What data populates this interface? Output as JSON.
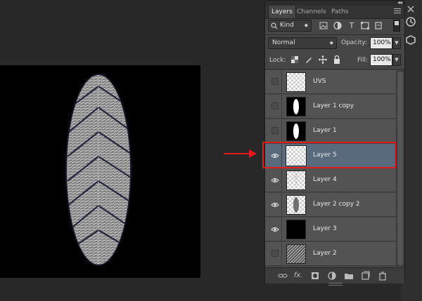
{
  "panel": {
    "tabs": [
      "Layers",
      "Channels",
      "Paths"
    ],
    "collapse": "◂◂",
    "filter": {
      "kind_label": "Kind"
    },
    "blend": {
      "mode": "Normal",
      "opacity_label": "Opacity:",
      "opacity_value": "100%"
    },
    "lock": {
      "label": "Lock:",
      "fill_label": "Fill:",
      "fill_value": "100%"
    },
    "layers": [
      {
        "name": "UVS",
        "visible": false,
        "thumb": "transparent"
      },
      {
        "name": "Layer 1 copy",
        "visible": false,
        "thumb": "white-shape"
      },
      {
        "name": "Layer 1",
        "visible": false,
        "thumb": "white-shape"
      },
      {
        "name": "Layer 5",
        "visible": true,
        "thumb": "transparent",
        "selected": true
      },
      {
        "name": "Layer 4",
        "visible": true,
        "thumb": "transparent"
      },
      {
        "name": "Layer 2 copy 2",
        "visible": true,
        "thumb": "feather"
      },
      {
        "name": "Layer 3",
        "visible": true,
        "thumb": "black"
      },
      {
        "name": "Layer 2",
        "visible": false,
        "thumb": "texture"
      }
    ],
    "footer_icons": [
      "link-icon",
      "fx-icon",
      "mask-icon",
      "adjustment-icon",
      "group-icon",
      "new-layer-icon",
      "trash-icon"
    ]
  },
  "annotation": {
    "arrow_color": "#e01b1b",
    "highlight_color": "#e01b1b"
  },
  "colors": {
    "selected_row": "#596a7d",
    "panel_bg": "#464646",
    "canvas_bg": "#000000"
  }
}
